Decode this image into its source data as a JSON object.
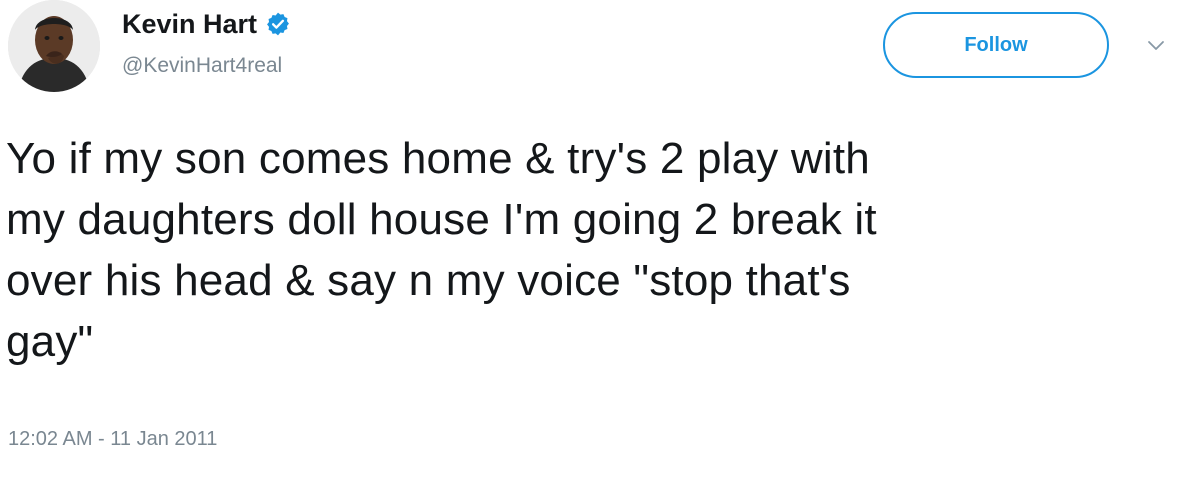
{
  "tweet": {
    "author": {
      "display_name": "Kevin Hart",
      "handle": "@KevinHart4real",
      "verified": true,
      "avatar_icon": "profile-photo"
    },
    "follow_label": "Follow",
    "menu_icon": "chevron-down-icon",
    "text_lines": [
      "Yo if my son comes home & try's 2 play with",
      "my daughters doll house I'm going 2 break it",
      "over his head & say n my voice \"stop that's",
      "gay\""
    ],
    "timestamp": "12:02 AM - 11 Jan 2011"
  },
  "colors": {
    "accent": "#1b95e0",
    "text": "#14171a",
    "secondary_text": "#7a8791",
    "background": "#ffffff"
  }
}
